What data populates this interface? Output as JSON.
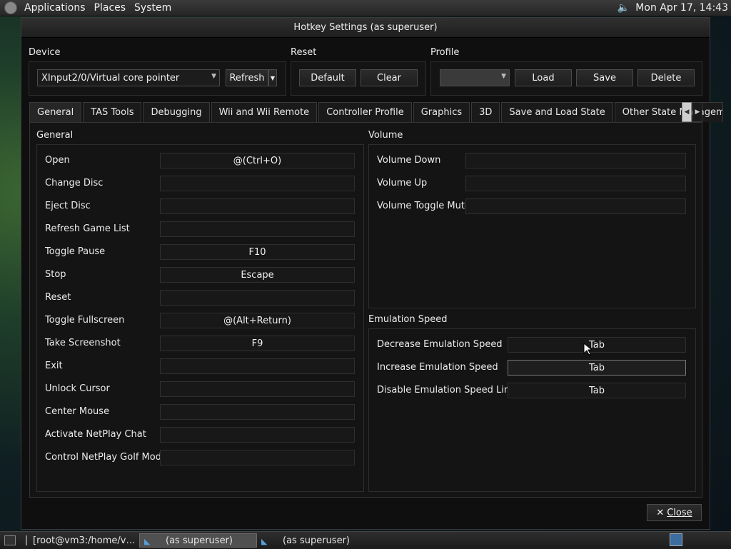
{
  "top_panel": {
    "menus": [
      "Applications",
      "Places",
      "System"
    ],
    "clock": "Mon Apr 17, 14:43"
  },
  "window": {
    "title": "Hotkey Settings (as superuser)",
    "device": {
      "label": "Device",
      "selected": "XInput2/0/Virtual core pointer",
      "refresh_label": "Refresh"
    },
    "reset": {
      "label": "Reset",
      "default_label": "Default",
      "clear_label": "Clear"
    },
    "profile": {
      "label": "Profile",
      "selected": "",
      "load_label": "Load",
      "save_label": "Save",
      "delete_label": "Delete"
    },
    "tabs": [
      "General",
      "TAS Tools",
      "Debugging",
      "Wii and Wii Remote",
      "Controller Profile",
      "Graphics",
      "3D",
      "Save and Load State",
      "Other State Managemen"
    ],
    "general_group": {
      "title": "General",
      "rows": [
        {
          "label": "Open",
          "value": "@(Ctrl+O)"
        },
        {
          "label": "Change Disc",
          "value": ""
        },
        {
          "label": "Eject Disc",
          "value": ""
        },
        {
          "label": "Refresh Game List",
          "value": ""
        },
        {
          "label": "Toggle Pause",
          "value": "F10"
        },
        {
          "label": "Stop",
          "value": "Escape"
        },
        {
          "label": "Reset",
          "value": ""
        },
        {
          "label": "Toggle Fullscreen",
          "value": "@(Alt+Return)"
        },
        {
          "label": "Take Screenshot",
          "value": "F9"
        },
        {
          "label": "Exit",
          "value": ""
        },
        {
          "label": "Unlock Cursor",
          "value": ""
        },
        {
          "label": "Center Mouse",
          "value": ""
        },
        {
          "label": "Activate NetPlay Chat",
          "value": ""
        },
        {
          "label": "Control NetPlay Golf Mode",
          "value": ""
        }
      ]
    },
    "volume_group": {
      "title": "Volume",
      "rows": [
        {
          "label": "Volume Down",
          "value": ""
        },
        {
          "label": "Volume Up",
          "value": ""
        },
        {
          "label": "Volume Toggle Mute",
          "value": ""
        }
      ]
    },
    "emulation_group": {
      "title": "Emulation Speed",
      "rows": [
        {
          "label": "Decrease Emulation Speed",
          "value": "Tab"
        },
        {
          "label": "Increase Emulation Speed",
          "value": "Tab"
        },
        {
          "label": "Disable Emulation Speed Limit",
          "value": "Tab"
        }
      ]
    },
    "close_label": "Close"
  },
  "taskbar": {
    "tasks": [
      "[root@vm3:/home/v…",
      "(as superuser)",
      "(as superuser)"
    ]
  }
}
